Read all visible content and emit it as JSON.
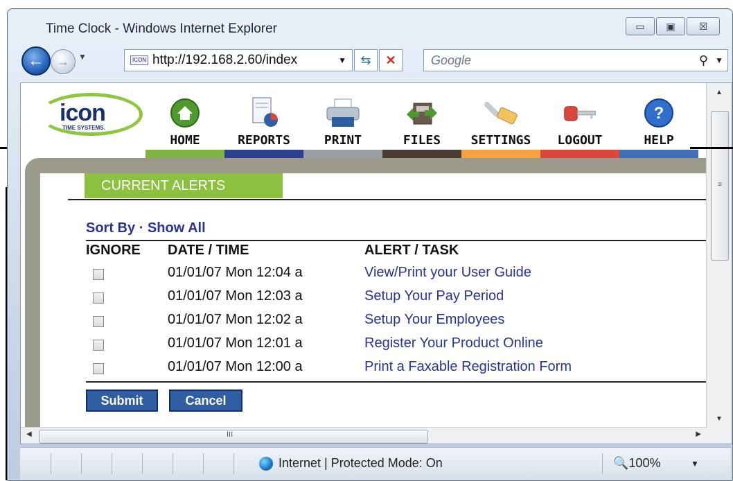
{
  "window": {
    "title": "Time Clock - Windows Internet Explorer",
    "controls": {
      "minimize": "▭",
      "maximize": "▣",
      "close": "☒"
    }
  },
  "navigation": {
    "back_glyph": "←",
    "forward_glyph": "→",
    "address": "http://192.168.2.60/index",
    "refresh_glyph": "⇆",
    "stop_glyph": "✕",
    "search_placeholder": "Google",
    "search_glyph": "⚲"
  },
  "logo": {
    "word": "icon",
    "sub": "TIME SYSTEMS."
  },
  "menu": [
    {
      "label": "HOME",
      "icon": "home-icon",
      "color": "#7db442"
    },
    {
      "label": "REPORTS",
      "icon": "reports-icon",
      "color": "#2f3f8f"
    },
    {
      "label": "PRINT",
      "icon": "print-icon",
      "color": "#9a9ea4"
    },
    {
      "label": "FILES",
      "icon": "files-icon",
      "color": "#4a3b33"
    },
    {
      "label": "SETTINGS",
      "icon": "settings-icon",
      "color": "#f4a340"
    },
    {
      "label": "LOGOUT",
      "icon": "logout-icon",
      "color": "#d9483a"
    },
    {
      "label": "HELP",
      "icon": "help-icon",
      "color": "#3f70b7"
    }
  ],
  "alerts": {
    "tab_label": "CURRENT ALERTS",
    "sort_by": "Sort By",
    "separator": "·",
    "show_all": "Show All",
    "columns": {
      "ignore": "IGNORE",
      "datetime": "DATE / TIME",
      "task": "ALERT / TASK"
    },
    "rows": [
      {
        "datetime": "01/01/07 Mon 12:04 a",
        "task": "View/Print your User Guide"
      },
      {
        "datetime": "01/01/07 Mon 12:03 a",
        "task": "Setup Your Pay Period"
      },
      {
        "datetime": "01/01/07 Mon 12:02 a",
        "task": "Setup Your Employees"
      },
      {
        "datetime": "01/01/07 Mon 12:01 a",
        "task": "Register Your Product Online"
      },
      {
        "datetime": "01/01/07 Mon 12:00 a",
        "task": "Print a Faxable Registration Form"
      }
    ],
    "submit": "Submit",
    "cancel": "Cancel"
  },
  "scroll": {
    "grip_v": "≡",
    "grip_h": "III"
  },
  "statusbar": {
    "zone": "Internet | Protected Mode: On",
    "zoom": "100%"
  }
}
